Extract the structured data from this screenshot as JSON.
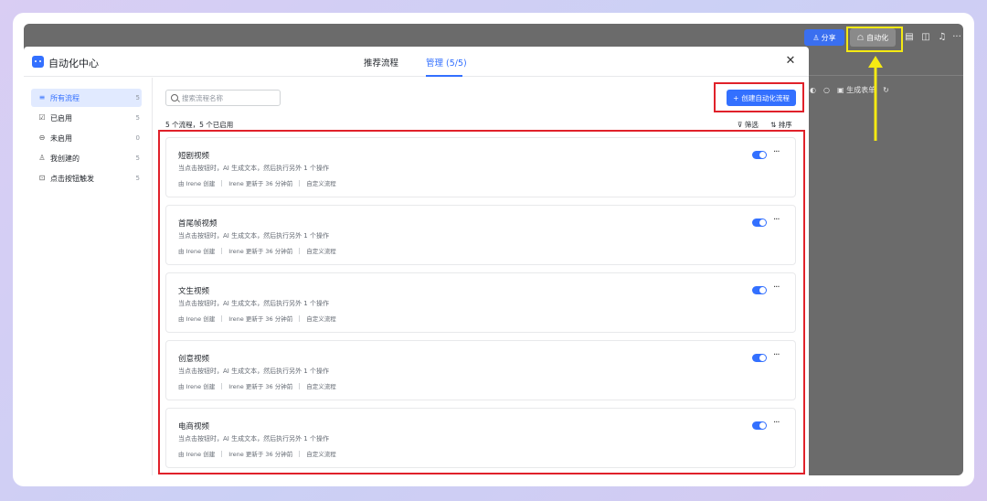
{
  "toolbar": {
    "share_label": "分享",
    "automation_label": "自动化",
    "more_icon": "···"
  },
  "background_panel": {
    "generate_form_label": "生成表单"
  },
  "modal": {
    "title": "自动化中心",
    "tabs": [
      {
        "label": "推荐流程"
      },
      {
        "label": "管理 (5/5)"
      }
    ],
    "close_glyph": "✕"
  },
  "sidebar": {
    "items": [
      {
        "label": "所有流程",
        "count": "5",
        "icon": "≡"
      },
      {
        "label": "已启用",
        "count": "5",
        "icon": "☑"
      },
      {
        "label": "未启用",
        "count": "0",
        "icon": "⊖"
      },
      {
        "label": "我创建的",
        "count": "5",
        "icon": "♙"
      },
      {
        "label": "点击按钮触发",
        "count": "5",
        "icon": "⊡"
      }
    ]
  },
  "main": {
    "search_placeholder": "搜索流程名称",
    "create_label": "创建自动化流程",
    "create_glyph": "+",
    "summary": "5 个流程，5 个已启用",
    "filter_label": "筛选",
    "sort_label": "排序",
    "more_glyph": "···",
    "cards": [
      {
        "title": "短剧视频",
        "desc": "当点击按钮时，AI 生成文本，然后执行另外 1 个操作",
        "creator": "由 Irene 创建",
        "updated": "Irene 更新于 36 分钟前",
        "type": "自定义流程"
      },
      {
        "title": "首尾帧视频",
        "desc": "当点击按钮时，AI 生成文本，然后执行另外 1 个操作",
        "creator": "由 Irene 创建",
        "updated": "Irene 更新于 36 分钟前",
        "type": "自定义流程"
      },
      {
        "title": "文生视频",
        "desc": "当点击按钮时，AI 生成文本，然后执行另外 1 个操作",
        "creator": "由 Irene 创建",
        "updated": "Irene 更新于 36 分钟前",
        "type": "自定义流程"
      },
      {
        "title": "创意视频",
        "desc": "当点击按钮时，AI 生成文本，然后执行另外 1 个操作",
        "creator": "由 Irene 创建",
        "updated": "Irene 更新于 36 分钟前",
        "type": "自定义流程"
      },
      {
        "title": "电商视频",
        "desc": "当点击按钮时，AI 生成文本，然后执行另外 1 个操作",
        "creator": "由 Irene 创建",
        "updated": "Irene 更新于 36 分钟前",
        "type": "自定义流程"
      }
    ]
  },
  "colors": {
    "accent": "#3370ff",
    "highlight_red": "#e0212a",
    "highlight_yellow": "#f5ea13"
  }
}
